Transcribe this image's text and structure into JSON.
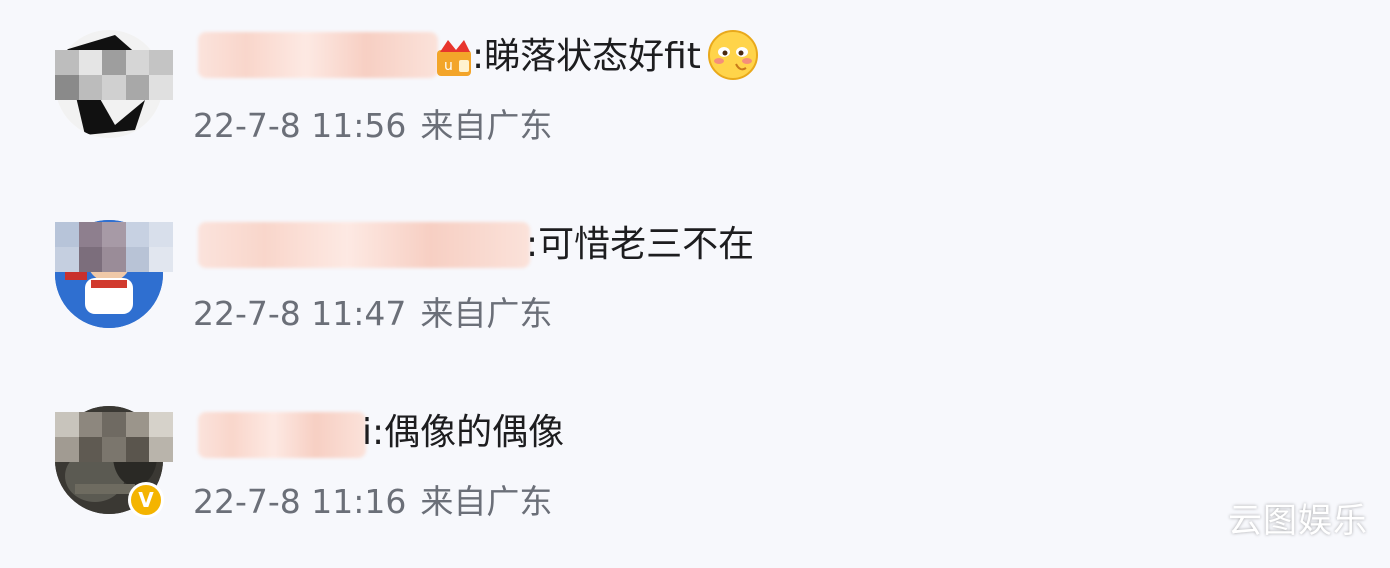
{
  "comments": [
    {
      "text": ":睇落状态好fit",
      "timestamp": "22-7-8 11:56",
      "location": "来自广东",
      "badge_icon": "vip-badge-icon",
      "trailing_icon": "blush-emoji-icon"
    },
    {
      "text": ":可惜老三不在",
      "timestamp": "22-7-8 11:47",
      "location": "来自广东"
    },
    {
      "text": "i:偶像的偶像",
      "timestamp": "22-7-8 11:16",
      "location": "来自广东",
      "avatar_badge": "verified-v-icon"
    }
  ],
  "watermark": "云图娱乐",
  "colors": {
    "background": "#f7f8fc",
    "text": "#1d1d1f",
    "meta": "#6b6f78",
    "verified": "#f4b400"
  }
}
